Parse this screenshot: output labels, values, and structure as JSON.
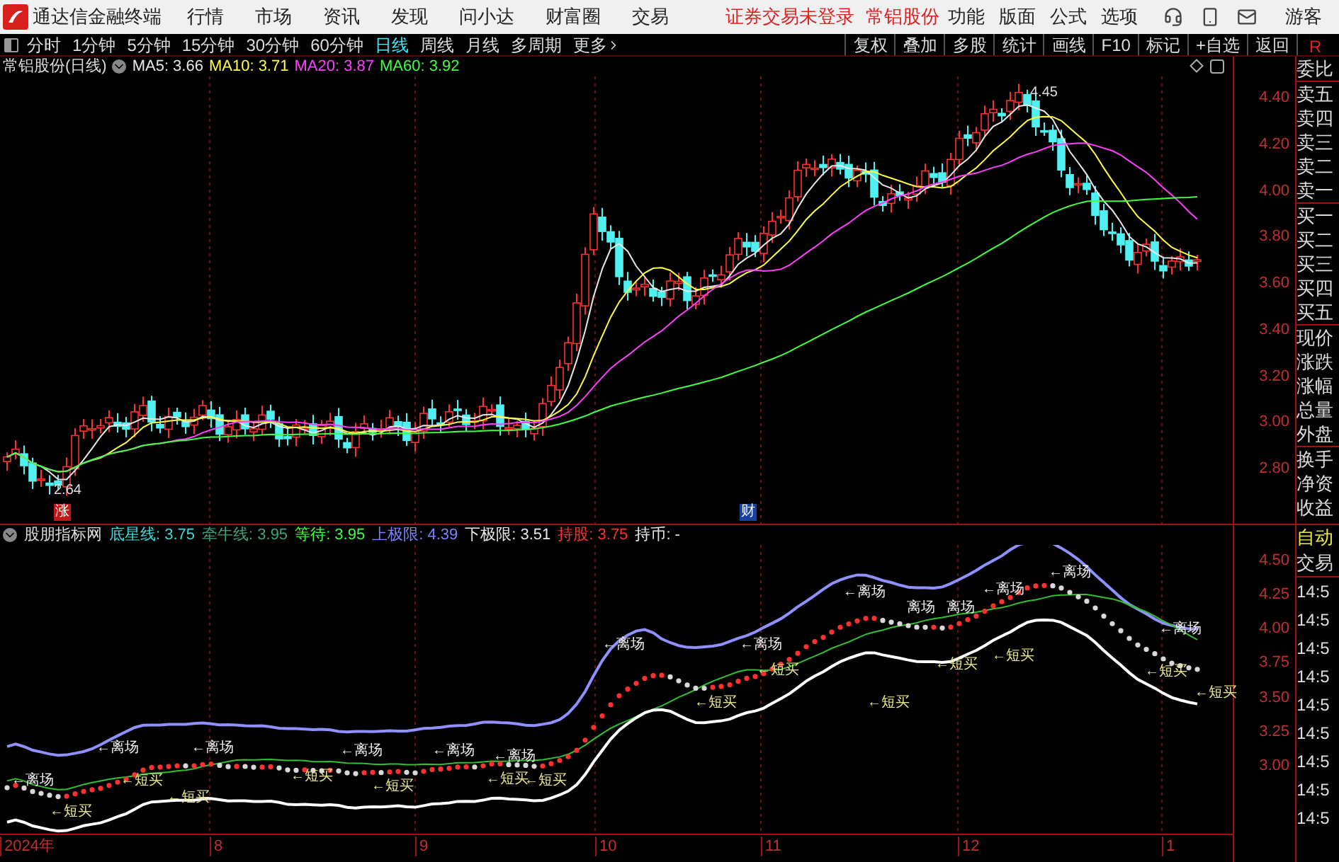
{
  "app": {
    "title": "通达信金融终端"
  },
  "menu": [
    "行情",
    "市场",
    "资讯",
    "发现",
    "问小达",
    "财富圈",
    "交易"
  ],
  "notice": [
    "证券交易未登录",
    "常铝股份"
  ],
  "right_menu": [
    "功能",
    "版面",
    "公式",
    "选项"
  ],
  "user": "游客",
  "periods": [
    {
      "label": "分时",
      "selected": false
    },
    {
      "label": "1分钟",
      "selected": false
    },
    {
      "label": "5分钟",
      "selected": false
    },
    {
      "label": "15分钟",
      "selected": false
    },
    {
      "label": "30分钟",
      "selected": false
    },
    {
      "label": "60分钟",
      "selected": false
    },
    {
      "label": "日线",
      "selected": true
    },
    {
      "label": "周线",
      "selected": false
    },
    {
      "label": "月线",
      "selected": false
    },
    {
      "label": "多周期",
      "selected": false
    },
    {
      "label": "更多",
      "selected": false
    }
  ],
  "tools": [
    "复权",
    "叠加",
    "多股",
    "统计",
    "画线",
    "F10",
    "标记",
    "+自选",
    "返回"
  ],
  "tool_r": "R",
  "chart": {
    "title": "常铝股份(日线)",
    "ma": [
      {
        "label": "MA5: 3.66",
        "color": "#e8e8e8"
      },
      {
        "label": "MA10: 3.71",
        "color": "#ffff40"
      },
      {
        "label": "MA20: 3.87",
        "color": "#ff40ff"
      },
      {
        "label": "MA60: 3.92",
        "color": "#40ff40"
      }
    ],
    "price_ticks": [
      "4.40",
      "4.20",
      "4.00",
      "3.80",
      "3.60",
      "3.40",
      "3.20",
      "3.00",
      "2.80"
    ],
    "high_label": "4.45",
    "low_label": "2.64",
    "events": [
      {
        "text": "涨",
        "color": "#c01818"
      },
      {
        "text": "财",
        "color": "#1840a0"
      }
    ]
  },
  "indicator": {
    "name": "股朋指标网",
    "readings": [
      {
        "label": "底星线: 3.75",
        "color": "#40d8d8"
      },
      {
        "label": "牵牛线: 3.95",
        "color": "#40a080"
      },
      {
        "label": "等待: 3.95",
        "color": "#40ff40"
      },
      {
        "label": "上极限: 4.39",
        "color": "#8080ff"
      },
      {
        "label": "下极限: 3.51",
        "color": "#e8e8e8"
      },
      {
        "label": "持股: 3.75",
        "color": "#ff3030"
      },
      {
        "label": "持币: -",
        "color": "#e8e8e8"
      }
    ],
    "ticks": [
      "4.50",
      "4.25",
      "4.00",
      "3.75",
      "3.50",
      "3.25",
      "3.00"
    ],
    "signals": [
      {
        "kind": "exit",
        "text": "←离场"
      },
      {
        "kind": "exit",
        "text": "←离场"
      },
      {
        "kind": "exit",
        "text": "←离场"
      },
      {
        "kind": "exit",
        "text": "←离场"
      },
      {
        "kind": "exit",
        "text": "←离场"
      },
      {
        "kind": "exit",
        "text": "←离场"
      },
      {
        "kind": "exit",
        "text": "←离场"
      },
      {
        "kind": "exit",
        "text": "←离场"
      },
      {
        "kind": "exit",
        "text": "←离场"
      },
      {
        "kind": "exit",
        "text": "←离场"
      },
      {
        "kind": "exit",
        "text": "←离场"
      },
      {
        "kind": "exit",
        "text": "离场"
      },
      {
        "kind": "exit",
        "text": "离场"
      },
      {
        "kind": "exit",
        "text": "←离场"
      },
      {
        "kind": "buy",
        "text": "←短买"
      },
      {
        "kind": "buy",
        "text": "←短买"
      },
      {
        "kind": "buy",
        "text": "←短买"
      },
      {
        "kind": "buy",
        "text": "←短买"
      },
      {
        "kind": "buy",
        "text": "←短买"
      },
      {
        "kind": "buy",
        "text": "←短买"
      },
      {
        "kind": "buy",
        "text": "←短买"
      },
      {
        "kind": "buy",
        "text": "←短买"
      },
      {
        "kind": "buy",
        "text": "←短买"
      },
      {
        "kind": "buy",
        "text": "←短买"
      },
      {
        "kind": "buy",
        "text": "←短买"
      },
      {
        "kind": "buy",
        "text": "←短买"
      },
      {
        "kind": "buy",
        "text": "←短买"
      },
      {
        "kind": "buy",
        "text": "←短买"
      }
    ]
  },
  "x_axis": [
    "2024年",
    "8",
    "9",
    "10",
    "11",
    "12",
    "1"
  ],
  "panel": {
    "quote_labels": [
      "委比",
      "卖五",
      "卖四",
      "卖三",
      "卖二",
      "卖一",
      "买一",
      "买二",
      "买三",
      "买四",
      "买五",
      "现价",
      "涨跌",
      "涨幅",
      "总量",
      "外盘",
      "换手",
      "净资",
      "收益"
    ],
    "mode": "自动",
    "trade": "交易",
    "times": [
      "14:5",
      "14:5",
      "14:5",
      "14:5",
      "14:5",
      "14:5",
      "14:5",
      "14:5",
      "14:5"
    ]
  }
}
